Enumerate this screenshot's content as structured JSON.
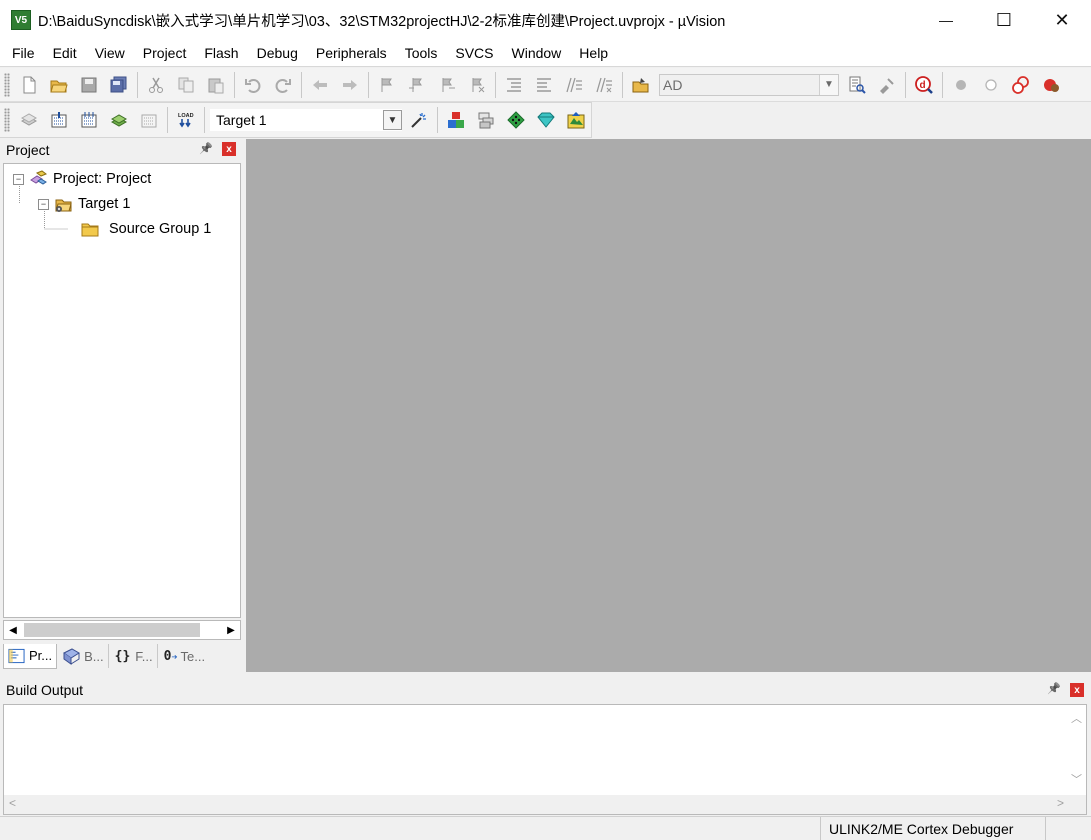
{
  "window": {
    "title": "D:\\BaiduSyncdisk\\嵌入式学习\\单片机学习\\03、32\\STM32projectHJ\\2-2标准库创建\\Project.uvprojx - µVision",
    "app_icon_text": "V5",
    "minimize": "—",
    "maximize": "☐",
    "close": "✕"
  },
  "menu": [
    "File",
    "Edit",
    "View",
    "Project",
    "Flash",
    "Debug",
    "Peripherals",
    "Tools",
    "SVCS",
    "Window",
    "Help"
  ],
  "toolbar": {
    "find_combo_value": "AD",
    "target_combo_value": "Target 1",
    "load_label": "LOAD"
  },
  "project_panel": {
    "title": "Project",
    "pin": "📌",
    "close": "x",
    "tree": {
      "root": "Project: Project",
      "target": "Target 1",
      "group": "Source Group 1"
    },
    "tabs": [
      "Pr...",
      "B...",
      "F...",
      "Te..."
    ],
    "tab_icons": [
      "{}",
      "0"
    ]
  },
  "build_output": {
    "title": "Build Output",
    "pin": "📌",
    "close": "x"
  },
  "status": {
    "debugger": "ULINK2/ME Cortex Debugger"
  },
  "colors": {
    "editor_bg": "#ababab",
    "close_red": "#d9302a"
  }
}
